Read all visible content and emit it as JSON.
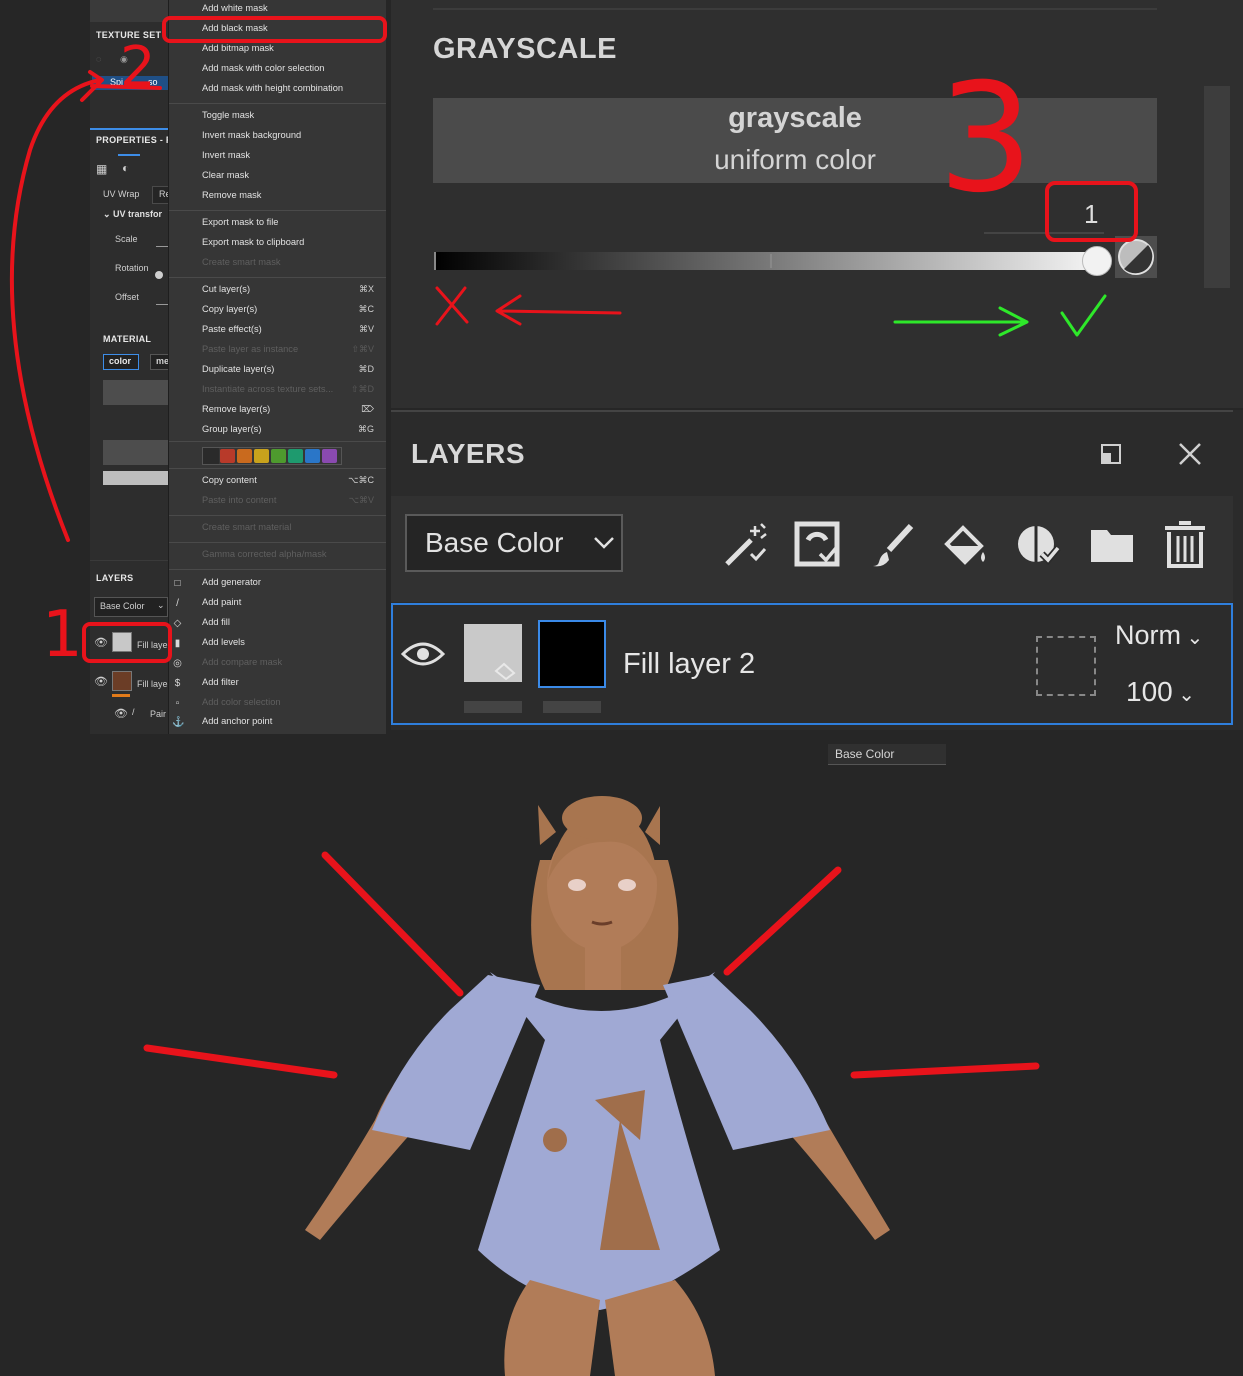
{
  "left_panel": {
    "texture_set_header": "TEXTURE SET",
    "texture_set_item": "Spi",
    "texture_set_item_tail": "so",
    "properties_header": "PROPERTIES - F",
    "uv_wrap_label": "UV Wrap",
    "uv_wrap_value": "Re",
    "uv_transform_label": "UV transfor",
    "scale_label": "Scale",
    "rotation_label": "Rotation",
    "offset_label": "Offset",
    "material_header": "MATERIAL",
    "material_tab_color": "color",
    "material_tab_next": "me",
    "layers_header": "LAYERS",
    "layers_channel": "Base Color",
    "layer_rows": [
      {
        "label": "Fill laye"
      },
      {
        "label": "Fill laye"
      },
      {
        "label": "Pair"
      }
    ]
  },
  "context_menu": {
    "items": [
      {
        "label": "Add white mask",
        "shortcut": "",
        "disabled": false
      },
      {
        "label": "Add black mask",
        "shortcut": "",
        "disabled": false,
        "highlighted": true
      },
      {
        "label": "Add bitmap mask",
        "shortcut": "",
        "disabled": false
      },
      {
        "label": "Add mask with color selection",
        "shortcut": "",
        "disabled": false
      },
      {
        "label": "Add mask with height combination",
        "shortcut": "",
        "disabled": false
      },
      {
        "label": "Toggle mask",
        "shortcut": "",
        "disabled": false
      },
      {
        "label": "Invert mask background",
        "shortcut": "",
        "disabled": false
      },
      {
        "label": "Invert mask",
        "shortcut": "",
        "disabled": false
      },
      {
        "label": "Clear mask",
        "shortcut": "",
        "disabled": false
      },
      {
        "label": "Remove mask",
        "shortcut": "",
        "disabled": false
      },
      {
        "label": "Export mask to file",
        "shortcut": "",
        "disabled": false
      },
      {
        "label": "Export mask to clipboard",
        "shortcut": "",
        "disabled": false
      },
      {
        "label": "Create smart mask",
        "shortcut": "",
        "disabled": true
      },
      {
        "label": "Cut layer(s)",
        "shortcut": "⌘X",
        "disabled": false
      },
      {
        "label": "Copy layer(s)",
        "shortcut": "⌘C",
        "disabled": false
      },
      {
        "label": "Paste effect(s)",
        "shortcut": "⌘V",
        "disabled": false
      },
      {
        "label": "Paste layer as instance",
        "shortcut": "⇧⌘V",
        "disabled": true
      },
      {
        "label": "Duplicate layer(s)",
        "shortcut": "⌘D",
        "disabled": false
      },
      {
        "label": "Instantiate across texture sets...",
        "shortcut": "⇧⌘D",
        "disabled": true
      },
      {
        "label": "Remove layer(s)",
        "shortcut": "⌦",
        "disabled": false
      },
      {
        "label": "Group layer(s)",
        "shortcut": "⌘G",
        "disabled": false
      },
      {
        "label": "Copy content",
        "shortcut": "⌥⌘C",
        "disabled": false
      },
      {
        "label": "Paste into content",
        "shortcut": "⌥⌘V",
        "disabled": true
      },
      {
        "label": "Create smart material",
        "shortcut": "",
        "disabled": true
      },
      {
        "label": "Gamma corrected alpha/mask",
        "shortcut": "",
        "disabled": true
      },
      {
        "label": "Add generator",
        "shortcut": "",
        "disabled": false
      },
      {
        "label": "Add paint",
        "shortcut": "",
        "disabled": false
      },
      {
        "label": "Add fill",
        "shortcut": "",
        "disabled": false
      },
      {
        "label": "Add levels",
        "shortcut": "",
        "disabled": false
      },
      {
        "label": "Add compare mask",
        "shortcut": "",
        "disabled": true
      },
      {
        "label": "Add filter",
        "shortcut": "",
        "disabled": false
      },
      {
        "label": "Add color selection",
        "shortcut": "",
        "disabled": true
      },
      {
        "label": "Add anchor point",
        "shortcut": "",
        "disabled": false
      }
    ],
    "color_tags": [
      "#b83a2a",
      "#c96a1e",
      "#c8a21c",
      "#4e9a2e",
      "#1e9a6e",
      "#2a76c8",
      "#8a4ab0"
    ]
  },
  "grayscale_panel": {
    "title": "GRAYSCALE",
    "mode_title": "grayscale",
    "mode_subtitle": "uniform color",
    "value": "1",
    "slider_value": 1.0
  },
  "layers_panel": {
    "title": "LAYERS",
    "channel": "Base Color",
    "layer": {
      "name": "Fill layer 2",
      "blend_mode": "Norm",
      "opacity": "100"
    },
    "tools": [
      "magic-wand-icon",
      "effect-icon",
      "brush-icon",
      "fill-bucket-icon",
      "smart-mask-icon",
      "folder-icon",
      "trash-icon"
    ]
  },
  "viewport": {
    "channel_tag": "Base Color"
  },
  "annotations": {
    "step_1": "1",
    "step_2": "2",
    "step_3": "3",
    "stroke_color": "#e8131b",
    "check_color": "#2ee82a"
  }
}
